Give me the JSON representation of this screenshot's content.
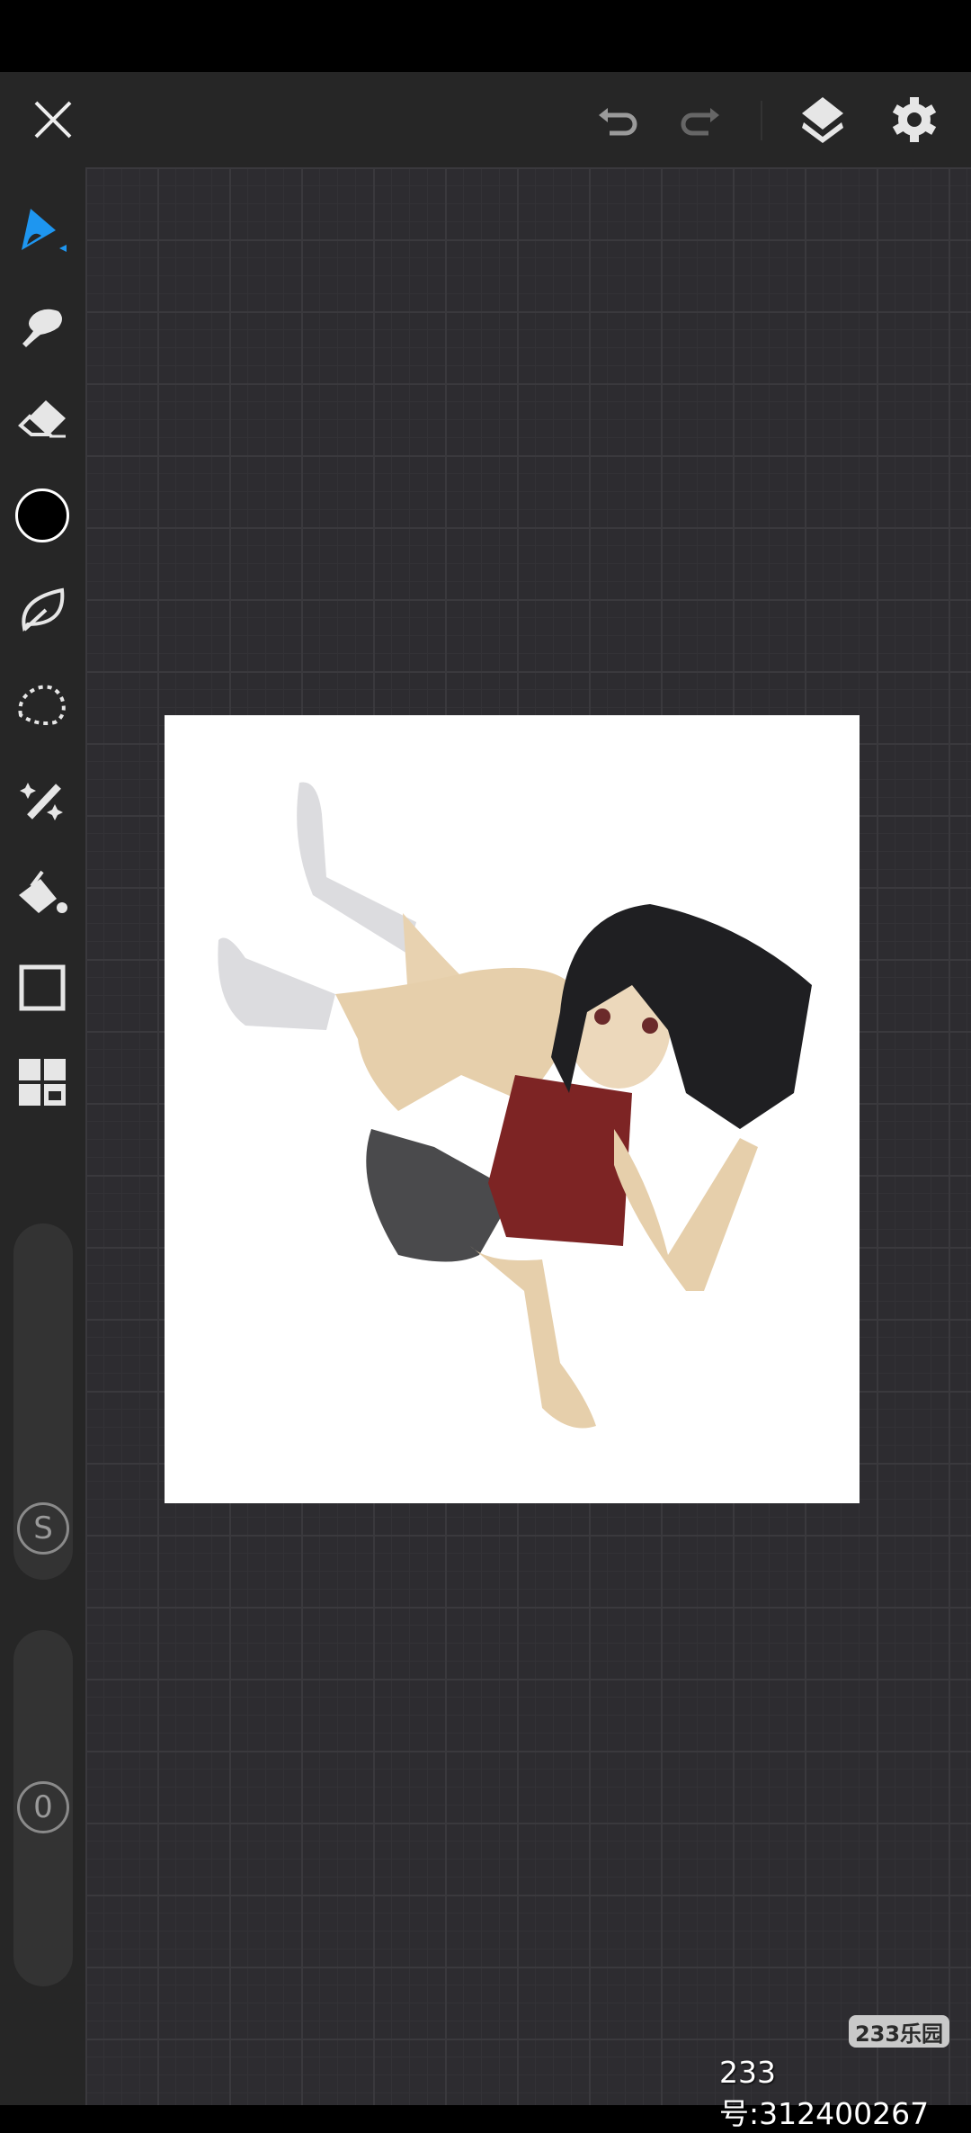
{
  "header": {
    "close_icon": "close-icon",
    "undo_icon": "undo-icon",
    "redo_icon": "redo-icon",
    "layers_icon": "layers-icon",
    "settings_icon": "gear-icon"
  },
  "tools": [
    "brush",
    "smudge",
    "eraser",
    "color",
    "leaf-brush",
    "lasso-select",
    "magic-wand",
    "paint-bucket",
    "shape",
    "grid-panels"
  ],
  "colors": {
    "accent": "#1e96f0",
    "current_color": "#000000"
  },
  "sliders": {
    "size_label": "S",
    "opacity_label": "0"
  },
  "watermark": {
    "badge": "233乐园",
    "id_text": "233号:312400267"
  }
}
